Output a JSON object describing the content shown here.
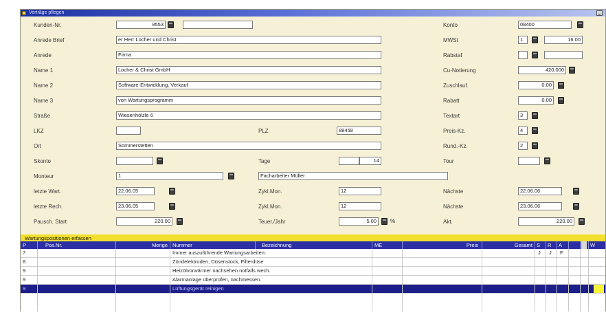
{
  "window": {
    "title": "Verträge pflegen"
  },
  "left_fields": [
    {
      "label": "Kunden-Nr.",
      "value": "8553",
      "extra": true
    },
    {
      "label": "Anrede Brief",
      "value": "er Herr Locher und Christ"
    },
    {
      "label": "Anrede",
      "value": "Firma"
    },
    {
      "label": "Name 1",
      "value": "Locher & Christ GmbH"
    },
    {
      "label": "Name 2",
      "value": "Software-Entwicklung, Verkauf"
    },
    {
      "label": "Name 3",
      "value": "von Wartungsprogramm"
    },
    {
      "label": "Straße",
      "value": "Wiesenhölzle 6"
    },
    {
      "label": "LKZ",
      "value": ""
    },
    {
      "label": "Ort",
      "value": "Sommerstetten"
    },
    {
      "label": "Skonto",
      "value": ""
    },
    {
      "label": "Monteur",
      "value": "1"
    },
    {
      "label": "letzte Wart.",
      "value": "22.06.05"
    },
    {
      "label": "letzte Rech.",
      "value": "23.06.05"
    },
    {
      "label": "Pausch. Start",
      "value": "220.00"
    }
  ],
  "mid_fields": {
    "plz_label": "PLZ",
    "plz_value": "88458",
    "tage_label": "Tage",
    "tage_value": "14",
    "monteur_name": "Facharbeiter Müller",
    "zykl1_label": "Zykl.Mon.",
    "zykl1_value": "12",
    "zykl2_label": "Zykl.Mon.",
    "zykl2_value": "12",
    "teuer_label": "Teuer./Jahr",
    "teuer_value": "5.00",
    "teuer_unit": "%"
  },
  "right_fields": [
    {
      "label": "Konto",
      "value": "08400"
    },
    {
      "label": "MWSt",
      "value": "1",
      "value2": "16.00"
    },
    {
      "label": "Rabstaf",
      "value": "",
      "value2": ""
    },
    {
      "label": "Cu-Notierung",
      "value": "420.000"
    },
    {
      "label": "Zuschlauf.",
      "value": "0.00"
    },
    {
      "label": "Rabatt",
      "value": "0.00"
    },
    {
      "label": "Textart",
      "value": "3"
    },
    {
      "label": "Preis-Kz.",
      "value": "4"
    },
    {
      "label": "Rund.-Kz.",
      "value": "2"
    },
    {
      "label": "Tour",
      "value": ""
    },
    {
      "label": "Nächste",
      "value": "22.06.06"
    },
    {
      "label": "Nächste",
      "value": "23.06.06"
    },
    {
      "label": "Akt.",
      "value": "220.00"
    }
  ],
  "section": {
    "title": "Wartungspositionen erfassen"
  },
  "table": {
    "headers": [
      "P",
      "Pos.Nr.",
      "Menge",
      "Nummer",
      "Bezeichnung",
      "ME",
      "Preis",
      "Gesamt",
      "S",
      "R",
      "A",
      "",
      "W"
    ],
    "rows": [
      {
        "p": "7",
        "text": "Immer auszuführende Wartungsarbeiten:",
        "s": "J",
        "r": "J",
        "a": "F"
      },
      {
        "p": "8",
        "text": "Zündelektroden, Düsenstock, Filterdüse",
        "s": "",
        "r": "",
        "a": ""
      },
      {
        "p": "9",
        "text": "Heizölvorwärmer nachsehen notfalls wech.",
        "s": "",
        "r": "",
        "a": ""
      },
      {
        "p": "9",
        "text": "Alarmanlage überprüfen, nachmessen.",
        "s": "",
        "r": "",
        "a": ""
      },
      {
        "p": "9",
        "text": "Lüftungsgerät reinigen",
        "s": "",
        "r": "",
        "a": ""
      }
    ]
  },
  "colors": {
    "title_bar": "#1c2fa0",
    "section_bar": "#f2df2e",
    "grid_header": "#2b2fa3",
    "selected_row": "#1c1e8a"
  }
}
